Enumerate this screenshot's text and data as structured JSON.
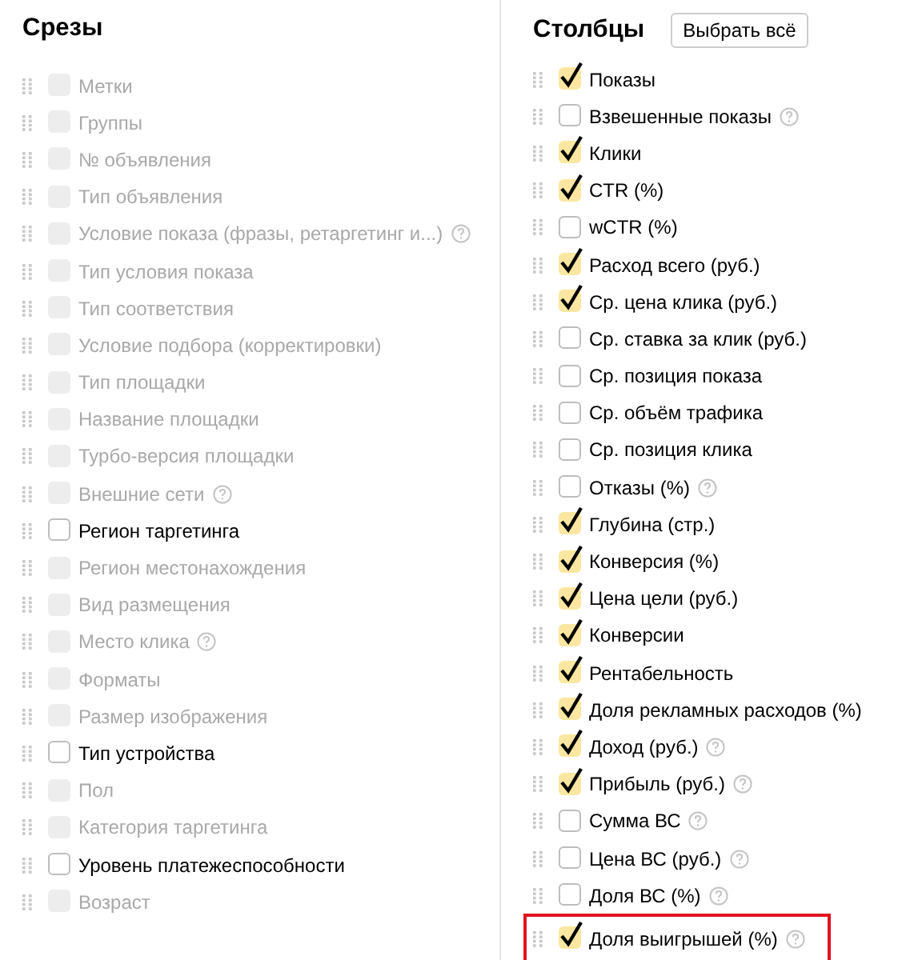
{
  "slices": {
    "title": "Срезы",
    "items": [
      {
        "label": "Метки",
        "disabled": true,
        "checked": false,
        "help": false
      },
      {
        "label": "Группы",
        "disabled": true,
        "checked": false,
        "help": false
      },
      {
        "label": "№ объявления",
        "disabled": true,
        "checked": false,
        "help": false
      },
      {
        "label": "Тип объявления",
        "disabled": true,
        "checked": false,
        "help": false
      },
      {
        "label": "Условие показа (фразы, ретаргетинг и...)",
        "disabled": true,
        "checked": false,
        "help": true
      },
      {
        "label": "Тип условия показа",
        "disabled": true,
        "checked": false,
        "help": false
      },
      {
        "label": "Тип соответствия",
        "disabled": true,
        "checked": false,
        "help": false
      },
      {
        "label": "Условие подбора (корректировки)",
        "disabled": true,
        "checked": false,
        "help": false
      },
      {
        "label": "Тип площадки",
        "disabled": true,
        "checked": false,
        "help": false
      },
      {
        "label": "Название площадки",
        "disabled": true,
        "checked": false,
        "help": false
      },
      {
        "label": "Турбо-версия площадки",
        "disabled": true,
        "checked": false,
        "help": false
      },
      {
        "label": "Внешние сети",
        "disabled": true,
        "checked": false,
        "help": true
      },
      {
        "label": "Регион таргетинга",
        "disabled": false,
        "checked": false,
        "help": false
      },
      {
        "label": "Регион местонахождения",
        "disabled": true,
        "checked": false,
        "help": false
      },
      {
        "label": "Вид размещения",
        "disabled": true,
        "checked": false,
        "help": false
      },
      {
        "label": "Место клика",
        "disabled": true,
        "checked": false,
        "help": true
      },
      {
        "label": "Форматы",
        "disabled": true,
        "checked": false,
        "help": false
      },
      {
        "label": "Размер изображения",
        "disabled": true,
        "checked": false,
        "help": false
      },
      {
        "label": "Тип устройства",
        "disabled": false,
        "checked": false,
        "help": false
      },
      {
        "label": "Пол",
        "disabled": true,
        "checked": false,
        "help": false
      },
      {
        "label": "Категория таргетинга",
        "disabled": true,
        "checked": false,
        "help": false
      },
      {
        "label": "Уровень платежеспособности",
        "disabled": false,
        "checked": false,
        "help": false
      },
      {
        "label": "Возраст",
        "disabled": true,
        "checked": false,
        "help": false
      }
    ]
  },
  "columns": {
    "title": "Столбцы",
    "select_all_button": "Выбрать всё",
    "items": [
      {
        "label": "Показы",
        "checked": true,
        "help": false,
        "highlighted": false
      },
      {
        "label": "Взвешенные показы",
        "checked": false,
        "help": true,
        "highlighted": false
      },
      {
        "label": "Клики",
        "checked": true,
        "help": false,
        "highlighted": false
      },
      {
        "label": "CTR (%)",
        "checked": true,
        "help": false,
        "highlighted": false
      },
      {
        "label": "wCTR (%)",
        "checked": false,
        "help": false,
        "highlighted": false
      },
      {
        "label": "Расход всего (руб.)",
        "checked": true,
        "help": false,
        "highlighted": false
      },
      {
        "label": "Ср. цена клика (руб.)",
        "checked": true,
        "help": false,
        "highlighted": false
      },
      {
        "label": "Ср. ставка за клик (руб.)",
        "checked": false,
        "help": false,
        "highlighted": false
      },
      {
        "label": "Ср. позиция показа",
        "checked": false,
        "help": false,
        "highlighted": false
      },
      {
        "label": "Ср. объём трафика",
        "checked": false,
        "help": false,
        "highlighted": false
      },
      {
        "label": "Ср. позиция клика",
        "checked": false,
        "help": false,
        "highlighted": false
      },
      {
        "label": "Отказы (%)",
        "checked": false,
        "help": true,
        "highlighted": false
      },
      {
        "label": "Глубина (стр.)",
        "checked": true,
        "help": false,
        "highlighted": false
      },
      {
        "label": "Конверсия (%)",
        "checked": true,
        "help": false,
        "highlighted": false
      },
      {
        "label": "Цена цели (руб.)",
        "checked": true,
        "help": false,
        "highlighted": false
      },
      {
        "label": "Конверсии",
        "checked": true,
        "help": false,
        "highlighted": false
      },
      {
        "label": "Рентабельность",
        "checked": true,
        "help": false,
        "highlighted": false
      },
      {
        "label": "Доля рекламных расходов (%)",
        "checked": true,
        "help": false,
        "highlighted": false
      },
      {
        "label": "Доход (руб.)",
        "checked": true,
        "help": true,
        "highlighted": false
      },
      {
        "label": "Прибыль (руб.)",
        "checked": true,
        "help": true,
        "highlighted": false
      },
      {
        "label": "Сумма ВС",
        "checked": false,
        "help": true,
        "highlighted": false
      },
      {
        "label": "Цена ВС (руб.)",
        "checked": false,
        "help": true,
        "highlighted": false
      },
      {
        "label": "Доля ВС (%)",
        "checked": false,
        "help": true,
        "highlighted": false
      },
      {
        "label": "Доля выигрышей (%)",
        "checked": true,
        "help": true,
        "highlighted": true
      }
    ]
  }
}
